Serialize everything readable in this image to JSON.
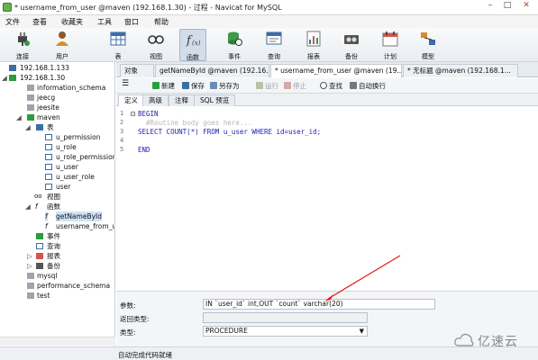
{
  "window": {
    "title": "* username_from_user @maven (192.168.1.30) - 过程 - Navicat for MySQL",
    "min": "–",
    "max": "□",
    "close": "✕"
  },
  "menu": [
    "文件",
    "查看",
    "收藏夹",
    "工具",
    "窗口",
    "帮助"
  ],
  "toolbar": [
    {
      "label": "连接",
      "icon": "plug-icon"
    },
    {
      "label": "用户",
      "icon": "user-icon"
    },
    {
      "label": "表",
      "icon": "table-icon"
    },
    {
      "label": "视图",
      "icon": "glasses-icon"
    },
    {
      "label": "函数",
      "icon": "function-icon",
      "selected": true
    },
    {
      "label": "事件",
      "icon": "event-icon"
    },
    {
      "label": "查询",
      "icon": "query-icon"
    },
    {
      "label": "报表",
      "icon": "report-icon"
    },
    {
      "label": "备份",
      "icon": "backup-icon"
    },
    {
      "label": "计划",
      "icon": "calendar-icon"
    },
    {
      "label": "模型",
      "icon": "model-icon"
    }
  ],
  "sidebar": {
    "tree": [
      {
        "label": "192.168.1.133",
        "depth": 0,
        "icon": "connection-icon"
      },
      {
        "label": "192.168.1.30",
        "depth": 0,
        "icon": "connection-icon"
      },
      {
        "label": "information_schema",
        "depth": 1,
        "icon": "database-icon"
      },
      {
        "label": "jeecg",
        "depth": 1,
        "icon": "database-icon"
      },
      {
        "label": "jeesite",
        "depth": 1,
        "icon": "database-icon"
      },
      {
        "label": "maven",
        "depth": 1,
        "icon": "database-open-icon"
      },
      {
        "label": "表",
        "depth": 2,
        "icon": "tables-folder-icon"
      },
      {
        "label": "u_permission",
        "depth": 3,
        "icon": "table-icon"
      },
      {
        "label": "u_role",
        "depth": 3,
        "icon": "table-icon"
      },
      {
        "label": "u_role_permission",
        "depth": 3,
        "icon": "table-icon"
      },
      {
        "label": "u_user",
        "depth": 3,
        "icon": "table-icon"
      },
      {
        "label": "u_user_role",
        "depth": 3,
        "icon": "table-icon"
      },
      {
        "label": "user",
        "depth": 3,
        "icon": "table-icon"
      },
      {
        "label": "视图",
        "depth": 2,
        "icon": "views-folder-icon"
      },
      {
        "label": "函数",
        "depth": 2,
        "icon": "functions-folder-icon"
      },
      {
        "label": "getNameById",
        "depth": 3,
        "icon": "function-icon",
        "selected": true
      },
      {
        "label": "username_from_u",
        "depth": 3,
        "icon": "function-icon"
      },
      {
        "label": "事件",
        "depth": 2,
        "icon": "events-folder-icon"
      },
      {
        "label": "查询",
        "depth": 2,
        "icon": "queries-folder-icon"
      },
      {
        "label": "报表",
        "depth": 2,
        "icon": "reports-folder-icon"
      },
      {
        "label": "备份",
        "depth": 2,
        "icon": "backups-folder-icon"
      },
      {
        "label": "mysql",
        "depth": 1,
        "icon": "database-icon"
      },
      {
        "label": "performance_schema",
        "depth": 1,
        "icon": "database-icon"
      },
      {
        "label": "test",
        "depth": 1,
        "icon": "database-icon"
      }
    ]
  },
  "tabs": [
    {
      "label": "对象"
    },
    {
      "label": "getNameById @maven (192.16..."
    },
    {
      "label": "* username_from_user @maven (19..."
    },
    {
      "label": "* 无标题 @maven (192.168.1..."
    }
  ],
  "editor_toolbar": {
    "menu": "☰",
    "new": "新建",
    "save": "保存",
    "save_as": "另存为",
    "run": "运行",
    "stop": "停止",
    "find": "查找",
    "autowrap": "自动换行"
  },
  "subtabs": [
    "定义",
    "高级",
    "注释",
    "SQL 预览"
  ],
  "code": {
    "lines": [
      {
        "n": "1",
        "text": "BEGIN"
      },
      {
        "n": "2",
        "text": "  #Routine body goes here..."
      },
      {
        "n": "3",
        "text": "SELECT COUNT(*) FROM u_user WHERE id=user_id;"
      },
      {
        "n": "4",
        "text": ""
      },
      {
        "n": "5",
        "text": "END"
      }
    ]
  },
  "properties": {
    "params_label": "参数:",
    "params_value": "IN `user_id` int,OUT `count` varchar(20)",
    "return_label": "返回类型:",
    "return_value": "",
    "type_label": "类型:",
    "type_value": "PROCEDURE"
  },
  "status": "自动完成代码就绪",
  "watermark": "亿速云"
}
